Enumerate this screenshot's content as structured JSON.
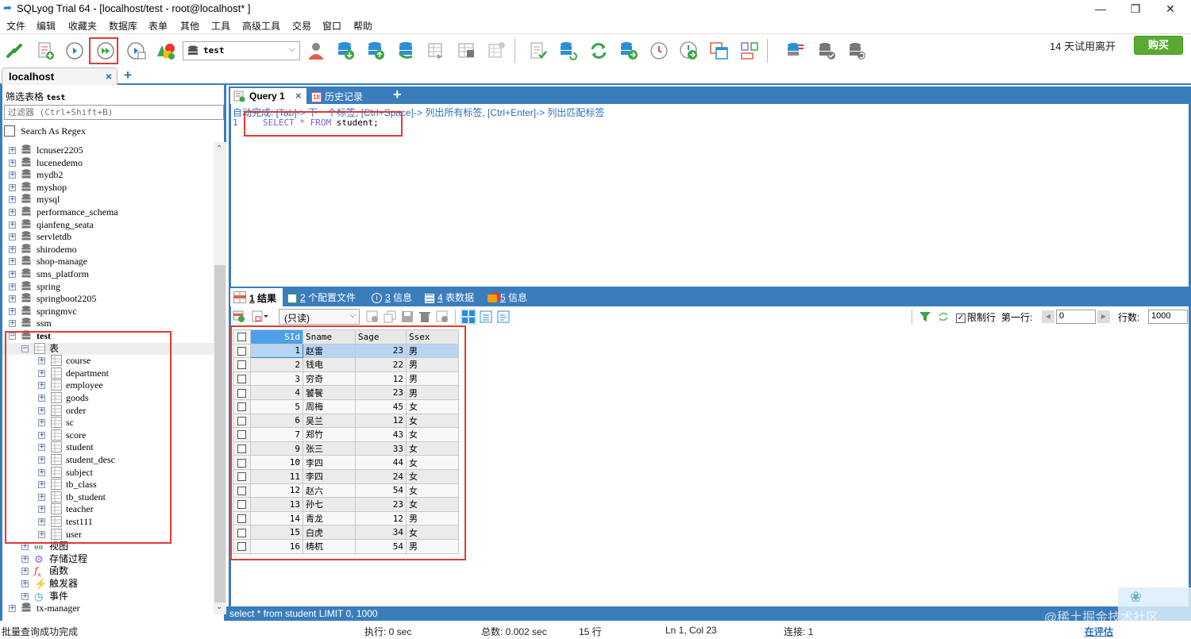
{
  "window": {
    "title": "SQLyog Trial 64 - [localhost/test - root@localhost* ]",
    "minimize": "—",
    "maximize": "❐",
    "close": "✕"
  },
  "menu": [
    "文件",
    "编辑",
    "收藏夹",
    "数据库",
    "表单",
    "其他",
    "工具",
    "高级工具",
    "交易",
    "窗口",
    "帮助"
  ],
  "toolbar": {
    "icons": [
      "new-connection-icon",
      "new-query-icon",
      "execute-query-icon",
      "execute-all-queries-icon",
      "execute-and-edit-icon",
      "schema-designer-icon",
      "user-manager-icon",
      "backup-database-icon",
      "restore-database-icon",
      "import-data-icon",
      "export-table-icon",
      "table-data-icon",
      "table-diagnostics-icon",
      "query-builder-icon",
      "schema-sync-icon",
      "data-sync-icon",
      "database-migration-icon",
      "scheduled-backup-icon",
      "job-agent-icon",
      "copy-table-icon",
      "visual-data-compare-icon",
      "database-compare-icon",
      "sync-database-icon",
      "restore-sync-icon"
    ],
    "database_select": "test",
    "trial_text": "14 天试用离开",
    "buy_label": "购买"
  },
  "connection_tab": {
    "label": "localhost",
    "close": "×",
    "add": "+"
  },
  "left_panel": {
    "filter_label": "筛选表格",
    "filter_db": "test",
    "filter_placeholder": "过滤器 (Ctrl+Shift+B)",
    "regex_label": "Search As Regex",
    "databases_before": [
      "lcnuser2205",
      "lucenedemo",
      "mydb2",
      "myshop",
      "mysql",
      "performance_schema",
      "qianfeng_seata",
      "servletdb",
      "shirodemo",
      "shop-manage",
      "sms_platform",
      "spring",
      "springboot2205",
      "springmvc",
      "ssm"
    ],
    "expanded_db": "test",
    "tables_folder": "表",
    "tables": [
      "course",
      "department",
      "employee",
      "goods",
      "order",
      "sc",
      "score",
      "student",
      "student_desc",
      "subject",
      "tb_class",
      "tb_student",
      "teacher",
      "test111",
      "user"
    ],
    "other_folders": [
      {
        "label": "视图",
        "icon": "views-icon"
      },
      {
        "label": "存储过程",
        "icon": "stored-procedures-icon"
      },
      {
        "label": "函数",
        "icon": "functions-icon"
      },
      {
        "label": "触发器",
        "icon": "triggers-icon"
      },
      {
        "label": "事件",
        "icon": "events-icon"
      }
    ],
    "databases_after": [
      "tx-manager"
    ]
  },
  "query_tabs": {
    "query_label": "Query 1",
    "close": "×",
    "history_label": "历史记录",
    "history_day": "18",
    "add": "+"
  },
  "editor": {
    "hint": "自动完成: [Tab]-> 下一个标签, [Ctrl+Space]-> 列出所有标签, [Ctrl+Enter]-> 列出匹配标签",
    "line_number": "1",
    "sql_tokens": [
      {
        "t": "SELECT",
        "kw": true
      },
      {
        "t": " "
      },
      {
        "t": "*",
        "kw": true
      },
      {
        "t": " "
      },
      {
        "t": "FROM",
        "kw": true
      },
      {
        "t": " student;"
      }
    ]
  },
  "result_tabs": [
    {
      "num": "1",
      "label": "结果"
    },
    {
      "num": "2",
      "label": "个配置文件"
    },
    {
      "num": "3",
      "label": "信息"
    },
    {
      "num": "4",
      "label": "表数据"
    },
    {
      "num": "5",
      "label": "信息"
    }
  ],
  "result_toolbar": {
    "mode": "(只读)",
    "limit_rows_label": "限制行",
    "limit_rows_checked": true,
    "first_row_label": "第一行:",
    "first_row_value": "0",
    "rows_label": "行数:",
    "rows_value": "1000"
  },
  "grid": {
    "columns": [
      "SId",
      "Sname",
      "Sage",
      "Ssex"
    ],
    "rows": [
      [
        "1",
        "赵雷",
        "23",
        "男"
      ],
      [
        "2",
        "钱电",
        "22",
        "男"
      ],
      [
        "3",
        "穷奇",
        "12",
        "男"
      ],
      [
        "4",
        "饕餮",
        "23",
        "男"
      ],
      [
        "5",
        "周梅",
        "45",
        "女"
      ],
      [
        "6",
        "吴兰",
        "12",
        "女"
      ],
      [
        "7",
        "郑竹",
        "43",
        "女"
      ],
      [
        "9",
        "张三",
        "33",
        "女"
      ],
      [
        "10",
        "李四",
        "44",
        "女"
      ],
      [
        "11",
        "李四",
        "24",
        "女"
      ],
      [
        "12",
        "赵六",
        "54",
        "女"
      ],
      [
        "13",
        "孙七",
        "23",
        "女"
      ],
      [
        "14",
        "青龙",
        "12",
        "男"
      ],
      [
        "15",
        "白虎",
        "34",
        "女"
      ],
      [
        "16",
        "梼杌",
        "54",
        "男"
      ]
    ],
    "selected_row": 0
  },
  "sql_status": "select * from student LIMIT 0, 1000",
  "status": {
    "message": "批量查询成功完成",
    "exec": "执行: 0 sec",
    "total": "总数: 0.002 sec",
    "rows": "15 行",
    "position": "Ln 1, Col 23",
    "connections": "连接: 1",
    "eval_link": "在评估",
    "watermark": "@稀土掘金技术社区"
  },
  "colors": {
    "accent": "#3a7dbd",
    "buy": "#5aaa32",
    "highlight": "#e53935",
    "keyword": "#7a5fd8",
    "selected_row": "#b7d5f3",
    "sid_header": "#4ea1e8"
  }
}
